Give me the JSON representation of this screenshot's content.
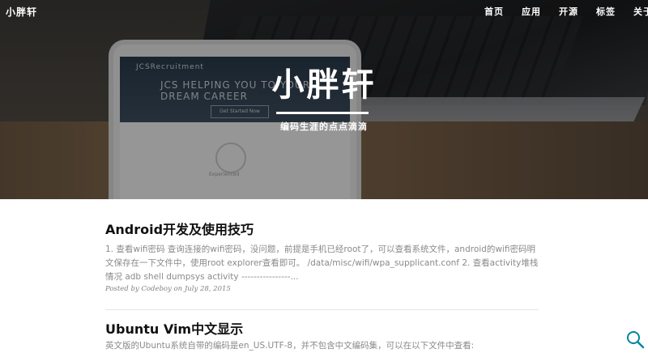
{
  "site": {
    "brand": "小胖轩",
    "title": "小胖轩",
    "subtitle": "编码生涯的点点滴滴"
  },
  "nav": {
    "items": [
      {
        "label": "首页"
      },
      {
        "label": "应用"
      },
      {
        "label": "开源"
      },
      {
        "label": "标签"
      },
      {
        "label": "关于"
      }
    ]
  },
  "hero_image": {
    "brand": "JCSRecruitment",
    "tagline": "JCS HELPING YOU TO YOUR DREAM CAREER",
    "cta": "Get Started Now",
    "feature": "Experienced"
  },
  "posts": [
    {
      "title": "Android开发及使用技巧",
      "excerpt": "1. 查看wifi密码 查询连接的wifi密码，没问题，前提是手机已经root了，可以查看系统文件，android的wifi密码明文保存在一下文件中，使用root explorer查看即可。 /data/misc/wifi/wpa_supplicant.conf 2. 查看activity堆栈情况 adb shell dumpsys activity ----------------...",
      "meta": "Posted by Codeboy on July 28, 2015"
    },
    {
      "title": "Ubuntu Vim中文显示",
      "excerpt": "英文版的Ubuntu系统自带的编码是en_US.UTF-8，并不包含中文编码集，可以在以下文件中查看:",
      "meta": ""
    }
  ],
  "search": {
    "icon": "search-icon",
    "color": "#0085a1"
  }
}
